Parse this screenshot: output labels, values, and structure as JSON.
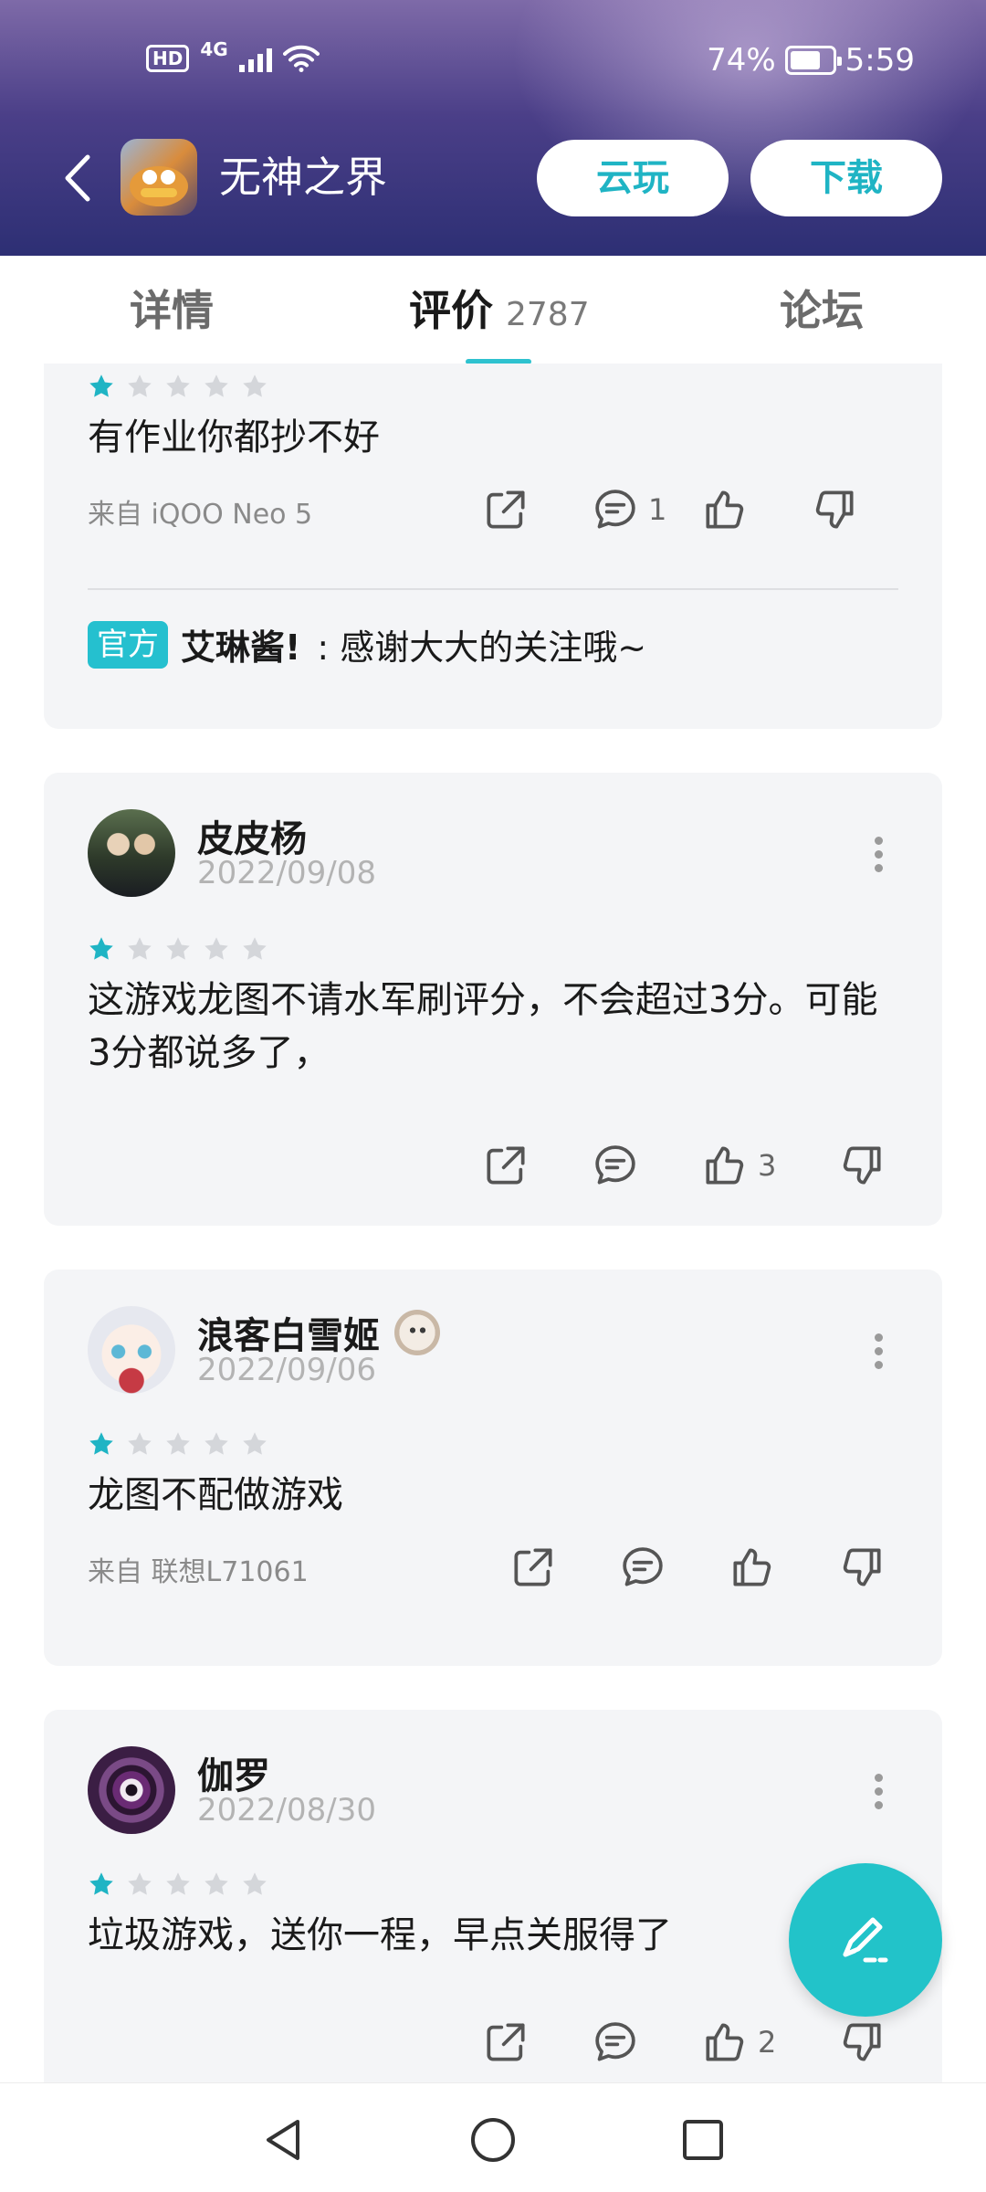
{
  "status_bar": {
    "hd": "HD",
    "network": "4G",
    "battery_percent": "74%",
    "time": "5:59",
    "battery_level": 0.74
  },
  "header": {
    "title": "无神之界",
    "cloud_play_label": "云玩",
    "download_label": "下载"
  },
  "tabs": {
    "details": "详情",
    "reviews": "评价",
    "reviews_count": "2787",
    "forum": "论坛"
  },
  "reviews": [
    {
      "rating": 1,
      "text": "有作业你都抄不好",
      "device": "来自 iQOO Neo 5",
      "comments": "1",
      "official_reply": {
        "badge": "官方",
        "name": "艾琳酱!",
        "text": ": 感谢大大的关注哦~"
      }
    },
    {
      "username": "皮皮杨",
      "date": "2022/09/08",
      "rating": 1,
      "text": "这游戏龙图不请水军刷评分，不会超过3分。可能3分都说多了，",
      "likes": "3"
    },
    {
      "username": "浪客白雪姬",
      "date": "2022/09/06",
      "rating": 1,
      "text": "龙图不配做游戏",
      "device": "来自 联想L71061"
    },
    {
      "username": "伽罗",
      "date": "2022/08/30",
      "rating": 1,
      "text": "垃圾游戏，送你一程，早点关服得了",
      "likes": "2"
    }
  ],
  "colors": {
    "accent": "#22c3c9",
    "star_active": "#1fb4c4",
    "star_inactive": "#d4d6da",
    "header_top": "#7e6aa8",
    "header_bottom": "#2d2f74"
  }
}
